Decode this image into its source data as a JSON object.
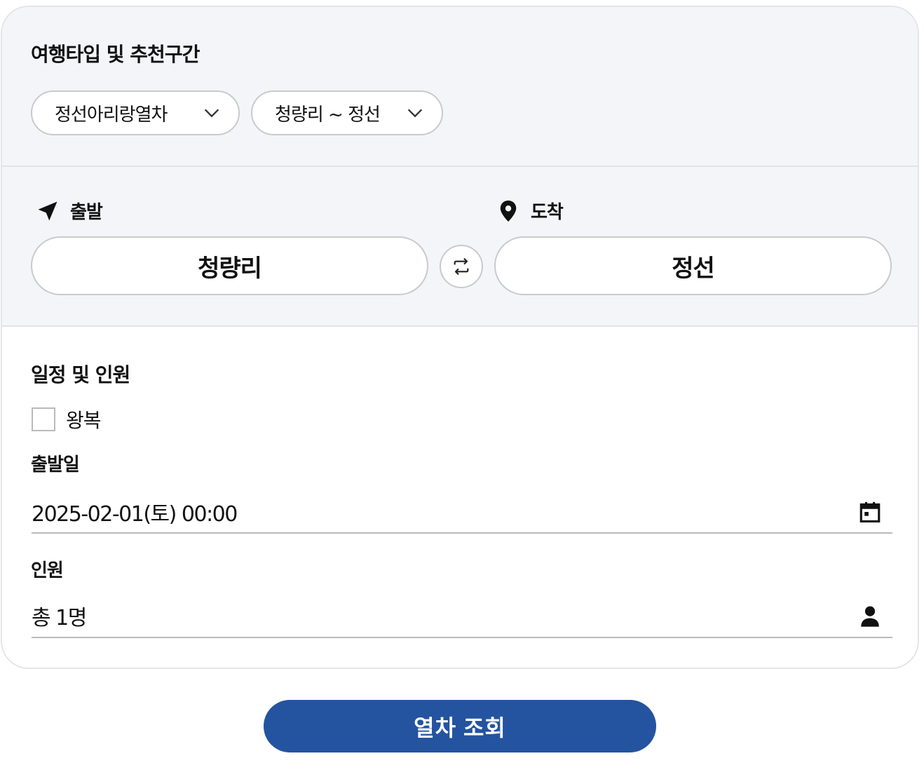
{
  "travel_type": {
    "title": "여행타입 및 추천구간",
    "train_select": "정선아리랑열차",
    "section_select": "청량리 ~ 정선"
  },
  "route": {
    "departure_label": "출발",
    "arrival_label": "도착",
    "departure_station": "청량리",
    "arrival_station": "정선",
    "icons": {
      "departure": "navigation-arrow-icon",
      "arrival": "map-pin-icon",
      "swap": "swap-arrows-icon"
    }
  },
  "schedule": {
    "title": "일정 및 인원",
    "roundtrip_label": "왕복",
    "roundtrip_checked": false,
    "departure_date_label": "출발일",
    "departure_date_value": "2025-02-01(토) 00:00",
    "passengers_label": "인원",
    "passengers_value": "총 1명",
    "icons": {
      "date": "calendar-icon",
      "passengers": "person-icon"
    }
  },
  "actions": {
    "search_label": "열차 조회"
  },
  "colors": {
    "accent": "#2453a0",
    "panel_bg": "#f4f5f9",
    "border": "#c9cacd"
  }
}
